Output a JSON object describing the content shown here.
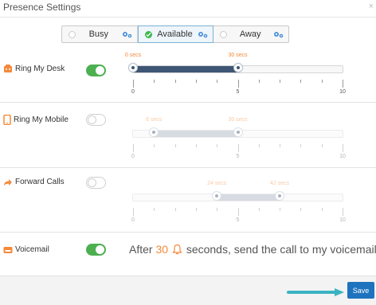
{
  "dialog": {
    "title": "Presence Settings",
    "close": "×"
  },
  "status": {
    "options": [
      {
        "label": "Busy",
        "selected": false
      },
      {
        "label": "Available",
        "selected": true
      },
      {
        "label": "Away",
        "selected": false
      }
    ]
  },
  "rows": [
    {
      "label": "Ring My Desk",
      "icon": "desk-phone-icon",
      "enabled": true,
      "slider": {
        "min": 0,
        "max": 10,
        "start": 0,
        "end": 5,
        "start_label": "0 secs",
        "end_label": "30 secs",
        "tick_labels": [
          "0",
          "5",
          "10"
        ]
      }
    },
    {
      "label": "Ring My Mobile",
      "icon": "mobile-phone-icon",
      "enabled": false,
      "slider": {
        "min": 0,
        "max": 10,
        "start": 1,
        "end": 5,
        "start_label": "6 secs",
        "end_label": "30 secs",
        "tick_labels": [
          "0",
          "5",
          "10"
        ]
      }
    },
    {
      "label": "Forward Calls",
      "icon": "forward-arrow-icon",
      "enabled": false,
      "slider": {
        "min": 0,
        "max": 10,
        "start": 4,
        "end": 7,
        "start_label": "24 secs",
        "end_label": "42 secs",
        "tick_labels": [
          "0",
          "5",
          "10"
        ]
      }
    }
  ],
  "voicemail": {
    "label": "Voicemail",
    "icon": "voicemail-icon",
    "enabled": true,
    "text_before": "After",
    "seconds": "30",
    "text_after": "seconds, send the call to my voicemail."
  },
  "footer": {
    "save_label": "Save"
  },
  "colors": {
    "accent": "#f5893a",
    "toggle_on": "#4caf50",
    "slider_fill": "#3e5674",
    "save_button": "#1e73be",
    "arrow": "#3bb3c3"
  }
}
